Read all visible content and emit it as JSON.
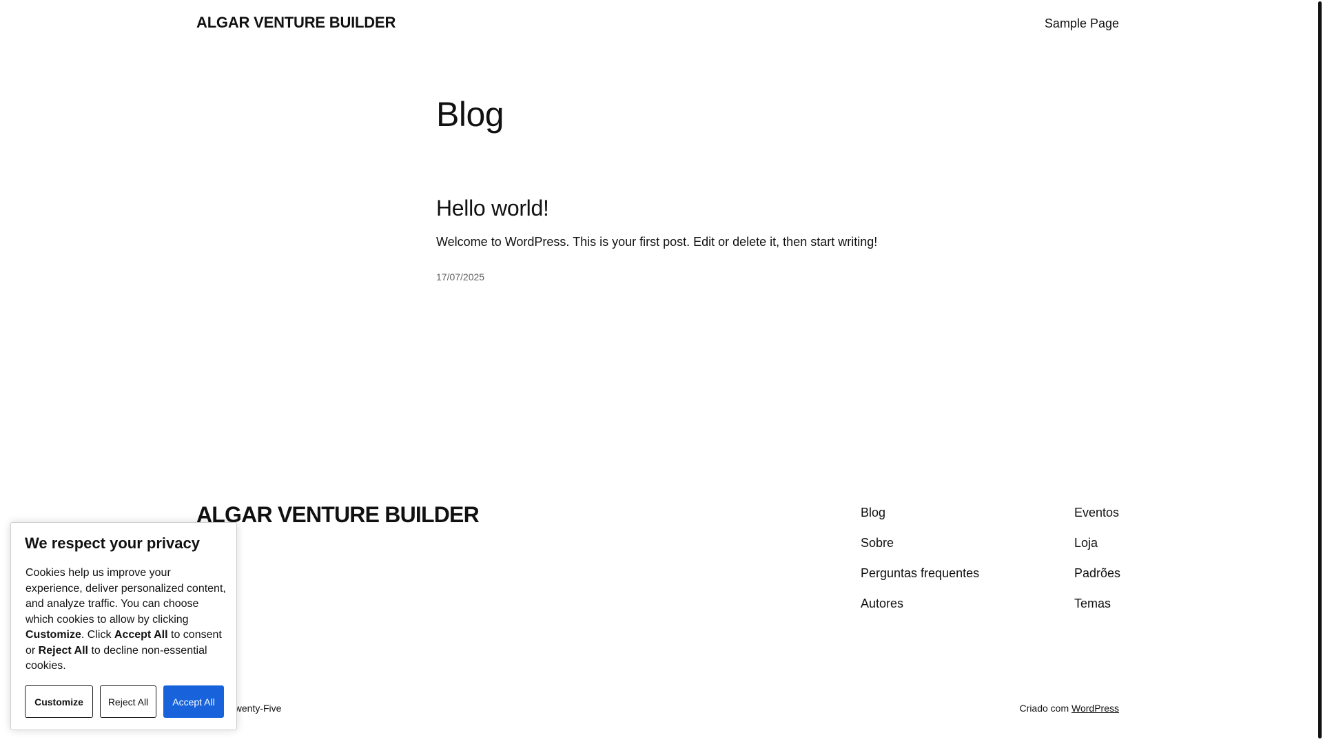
{
  "header": {
    "site_title": "ALGAR VENTURE BUILDER",
    "nav": {
      "sample_page": "Sample Page"
    }
  },
  "main": {
    "page_heading": "Blog",
    "posts": [
      {
        "title": "Hello world!",
        "excerpt": "Welcome to WordPress. This is your first post. Edit or delete it, then start writing!",
        "date": "17/07/2025"
      }
    ]
  },
  "footer": {
    "site_title": "ALGAR VENTURE BUILDER",
    "nav_col_1": [
      "Blog",
      "Sobre",
      "Perguntas frequentes",
      "Autores"
    ],
    "nav_col_2": [
      "Eventos",
      "Loja",
      "Padrões",
      "Temas"
    ],
    "theme_credit": "Twenty Twenty-Five",
    "credit_prefix": "Criado com ",
    "credit_link": "WordPress"
  },
  "cookie_banner": {
    "heading": "We respect your privacy",
    "text_part_1": "Cookies help us improve your experience, deliver personalized content, and analyze traffic. You can choose which cookies to allow by clicking ",
    "text_bold_customize": "Customize",
    "text_part_2": ". Click ",
    "text_bold_accept": "Accept All",
    "text_part_3": " to consent or ",
    "text_bold_reject": "Reject All",
    "text_part_4": " to decline non-essential cookies.",
    "buttons": {
      "customize": "Customize",
      "reject": "Reject All",
      "accept": "Accept All"
    }
  },
  "colors": {
    "accept_button": "#1863dc",
    "text": "#111111",
    "date_text": "#5f5f5f"
  }
}
